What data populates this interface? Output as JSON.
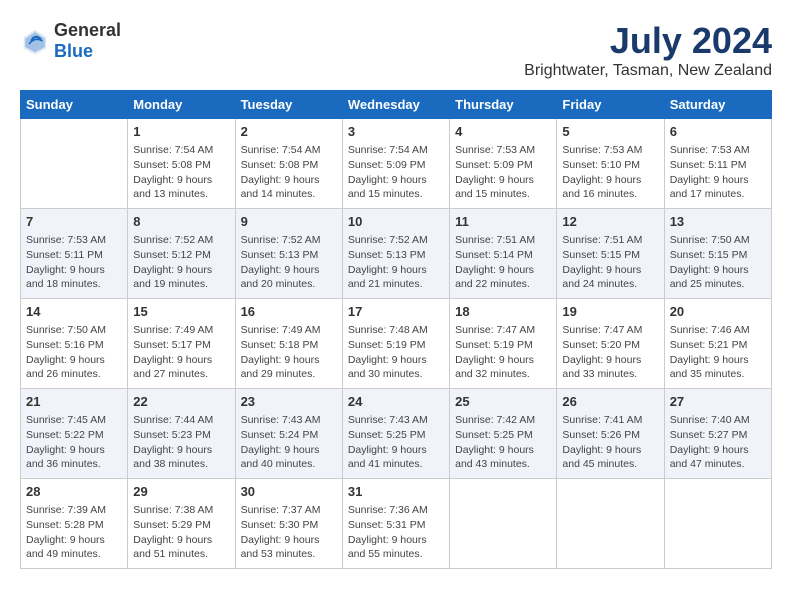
{
  "header": {
    "logo_general": "General",
    "logo_blue": "Blue",
    "month": "July 2024",
    "location": "Brightwater, Tasman, New Zealand"
  },
  "days_of_week": [
    "Sunday",
    "Monday",
    "Tuesday",
    "Wednesday",
    "Thursday",
    "Friday",
    "Saturday"
  ],
  "weeks": [
    [
      {
        "day": "",
        "content": ""
      },
      {
        "day": "1",
        "content": "Sunrise: 7:54 AM\nSunset: 5:08 PM\nDaylight: 9 hours\nand 13 minutes."
      },
      {
        "day": "2",
        "content": "Sunrise: 7:54 AM\nSunset: 5:08 PM\nDaylight: 9 hours\nand 14 minutes."
      },
      {
        "day": "3",
        "content": "Sunrise: 7:54 AM\nSunset: 5:09 PM\nDaylight: 9 hours\nand 15 minutes."
      },
      {
        "day": "4",
        "content": "Sunrise: 7:53 AM\nSunset: 5:09 PM\nDaylight: 9 hours\nand 15 minutes."
      },
      {
        "day": "5",
        "content": "Sunrise: 7:53 AM\nSunset: 5:10 PM\nDaylight: 9 hours\nand 16 minutes."
      },
      {
        "day": "6",
        "content": "Sunrise: 7:53 AM\nSunset: 5:11 PM\nDaylight: 9 hours\nand 17 minutes."
      }
    ],
    [
      {
        "day": "7",
        "content": "Sunrise: 7:53 AM\nSunset: 5:11 PM\nDaylight: 9 hours\nand 18 minutes."
      },
      {
        "day": "8",
        "content": "Sunrise: 7:52 AM\nSunset: 5:12 PM\nDaylight: 9 hours\nand 19 minutes."
      },
      {
        "day": "9",
        "content": "Sunrise: 7:52 AM\nSunset: 5:13 PM\nDaylight: 9 hours\nand 20 minutes."
      },
      {
        "day": "10",
        "content": "Sunrise: 7:52 AM\nSunset: 5:13 PM\nDaylight: 9 hours\nand 21 minutes."
      },
      {
        "day": "11",
        "content": "Sunrise: 7:51 AM\nSunset: 5:14 PM\nDaylight: 9 hours\nand 22 minutes."
      },
      {
        "day": "12",
        "content": "Sunrise: 7:51 AM\nSunset: 5:15 PM\nDaylight: 9 hours\nand 24 minutes."
      },
      {
        "day": "13",
        "content": "Sunrise: 7:50 AM\nSunset: 5:15 PM\nDaylight: 9 hours\nand 25 minutes."
      }
    ],
    [
      {
        "day": "14",
        "content": "Sunrise: 7:50 AM\nSunset: 5:16 PM\nDaylight: 9 hours\nand 26 minutes."
      },
      {
        "day": "15",
        "content": "Sunrise: 7:49 AM\nSunset: 5:17 PM\nDaylight: 9 hours\nand 27 minutes."
      },
      {
        "day": "16",
        "content": "Sunrise: 7:49 AM\nSunset: 5:18 PM\nDaylight: 9 hours\nand 29 minutes."
      },
      {
        "day": "17",
        "content": "Sunrise: 7:48 AM\nSunset: 5:19 PM\nDaylight: 9 hours\nand 30 minutes."
      },
      {
        "day": "18",
        "content": "Sunrise: 7:47 AM\nSunset: 5:19 PM\nDaylight: 9 hours\nand 32 minutes."
      },
      {
        "day": "19",
        "content": "Sunrise: 7:47 AM\nSunset: 5:20 PM\nDaylight: 9 hours\nand 33 minutes."
      },
      {
        "day": "20",
        "content": "Sunrise: 7:46 AM\nSunset: 5:21 PM\nDaylight: 9 hours\nand 35 minutes."
      }
    ],
    [
      {
        "day": "21",
        "content": "Sunrise: 7:45 AM\nSunset: 5:22 PM\nDaylight: 9 hours\nand 36 minutes."
      },
      {
        "day": "22",
        "content": "Sunrise: 7:44 AM\nSunset: 5:23 PM\nDaylight: 9 hours\nand 38 minutes."
      },
      {
        "day": "23",
        "content": "Sunrise: 7:43 AM\nSunset: 5:24 PM\nDaylight: 9 hours\nand 40 minutes."
      },
      {
        "day": "24",
        "content": "Sunrise: 7:43 AM\nSunset: 5:25 PM\nDaylight: 9 hours\nand 41 minutes."
      },
      {
        "day": "25",
        "content": "Sunrise: 7:42 AM\nSunset: 5:25 PM\nDaylight: 9 hours\nand 43 minutes."
      },
      {
        "day": "26",
        "content": "Sunrise: 7:41 AM\nSunset: 5:26 PM\nDaylight: 9 hours\nand 45 minutes."
      },
      {
        "day": "27",
        "content": "Sunrise: 7:40 AM\nSunset: 5:27 PM\nDaylight: 9 hours\nand 47 minutes."
      }
    ],
    [
      {
        "day": "28",
        "content": "Sunrise: 7:39 AM\nSunset: 5:28 PM\nDaylight: 9 hours\nand 49 minutes."
      },
      {
        "day": "29",
        "content": "Sunrise: 7:38 AM\nSunset: 5:29 PM\nDaylight: 9 hours\nand 51 minutes."
      },
      {
        "day": "30",
        "content": "Sunrise: 7:37 AM\nSunset: 5:30 PM\nDaylight: 9 hours\nand 53 minutes."
      },
      {
        "day": "31",
        "content": "Sunrise: 7:36 AM\nSunset: 5:31 PM\nDaylight: 9 hours\nand 55 minutes."
      },
      {
        "day": "",
        "content": ""
      },
      {
        "day": "",
        "content": ""
      },
      {
        "day": "",
        "content": ""
      }
    ]
  ]
}
